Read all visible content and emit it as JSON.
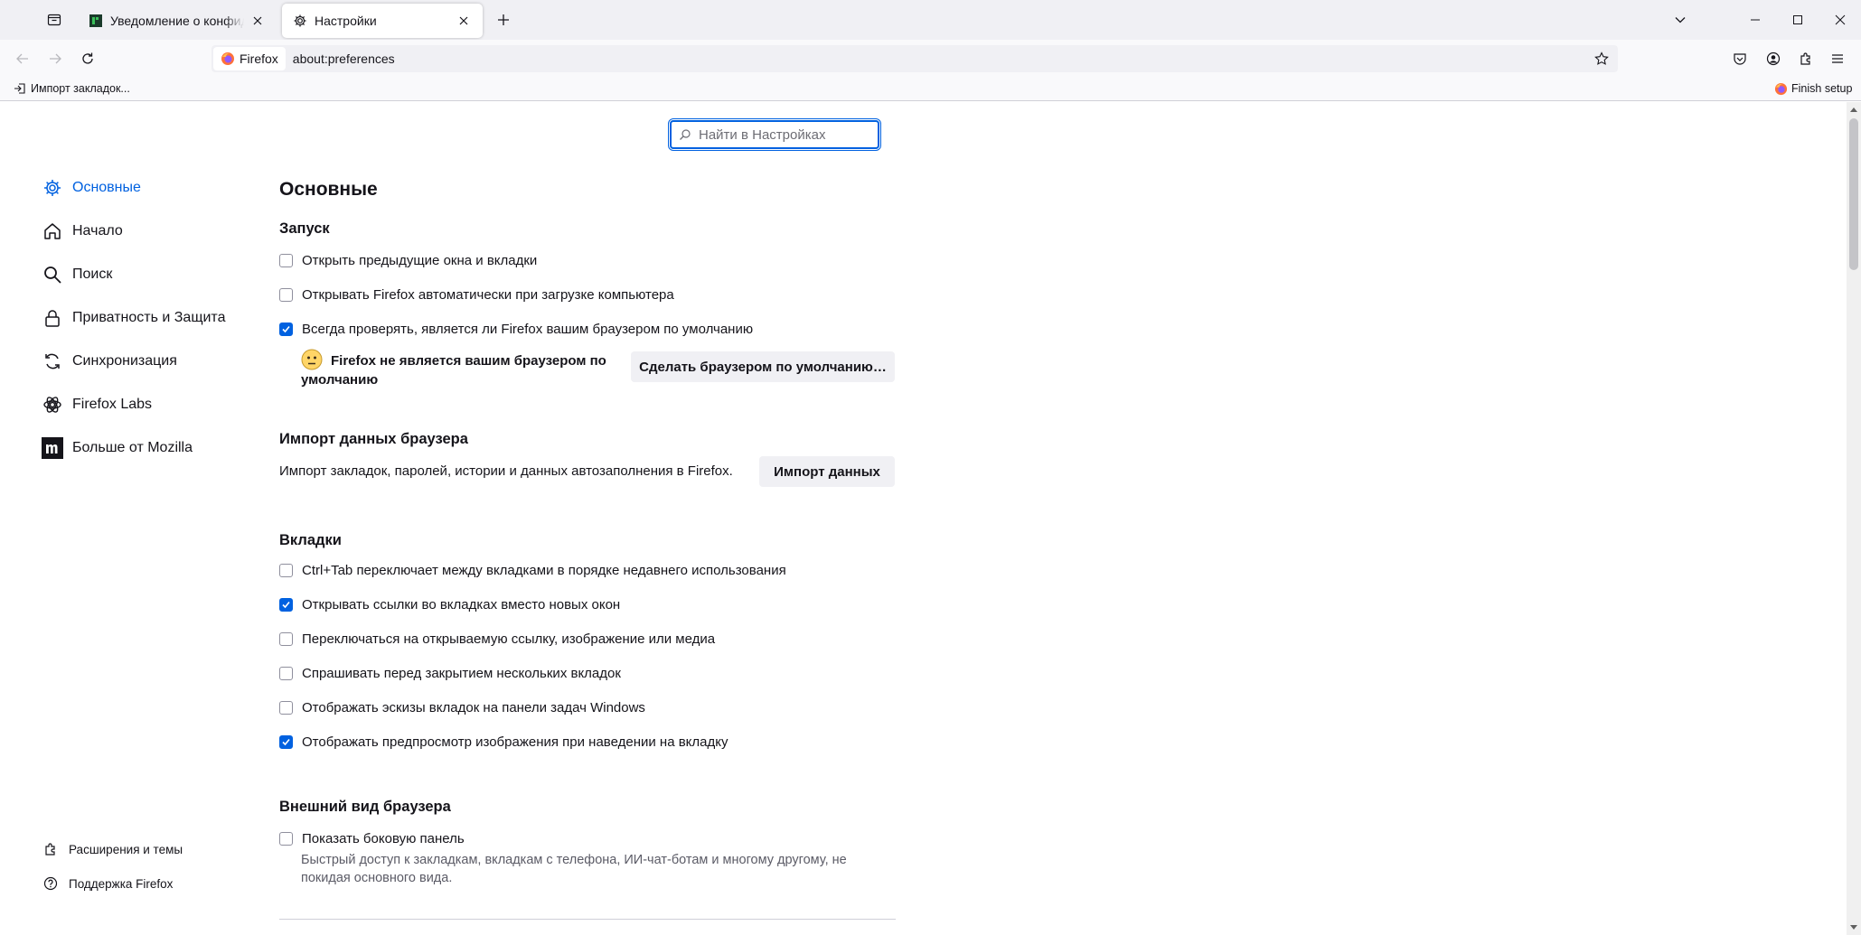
{
  "tabs": [
    {
      "title": "Уведомление о конфиденциальности",
      "active": false
    },
    {
      "title": "Настройки",
      "active": true
    }
  ],
  "urlbar": {
    "identity_label": "Firefox",
    "url": "about:preferences"
  },
  "bookmarks": {
    "import_label": "Импорт закладок...",
    "finish_setup_label": "Finish setup"
  },
  "search": {
    "placeholder": "Найти в Настройках"
  },
  "sidebar": {
    "categories": [
      {
        "label": "Основные",
        "icon": "gear-icon",
        "selected": true
      },
      {
        "label": "Начало",
        "icon": "home-icon",
        "selected": false
      },
      {
        "label": "Поиск",
        "icon": "search-icon",
        "selected": false
      },
      {
        "label": "Приватность и Защита",
        "icon": "lock-icon",
        "selected": false
      },
      {
        "label": "Синхронизация",
        "icon": "sync-icon",
        "selected": false
      },
      {
        "label": "Firefox Labs",
        "icon": "labs-icon",
        "selected": false
      },
      {
        "label": "Больше от Mozilla",
        "icon": "mozilla-icon",
        "selected": false
      }
    ],
    "footer": {
      "addons_label": "Расширения и темы",
      "support_label": "Поддержка Firefox"
    }
  },
  "main": {
    "title": "Основные",
    "startup": {
      "heading": "Запуск",
      "options": [
        {
          "label": "Открыть предыдущие окна и вкладки",
          "checked": false
        },
        {
          "label": "Открывать Firefox автоматически при загрузке компьютера",
          "checked": false
        },
        {
          "label": "Всегда проверять, является ли Firefox вашим браузером по умолчанию",
          "checked": true
        }
      ],
      "default_status": "Firefox не является вашим браузером по умолчанию",
      "default_status_line1": "Firefox не является вашим браузером по",
      "default_status_line2": "умолчанию",
      "make_default_button": "Сделать браузером по умолчанию…"
    },
    "import": {
      "heading": "Импорт данных браузера",
      "description": "Импорт закладок, паролей, истории и данных автозаполнения в Firefox.",
      "button": "Импорт данных"
    },
    "tabs_section": {
      "heading": "Вкладки",
      "options": [
        {
          "label": "Ctrl+Tab переключает между вкладками в порядке недавнего использования",
          "checked": false
        },
        {
          "label": "Открывать ссылки во вкладках вместо новых окон",
          "checked": true
        },
        {
          "label": "Переключаться на открываемую ссылку, изображение или медиа",
          "checked": false
        },
        {
          "label": "Спрашивать перед закрытием нескольких вкладок",
          "checked": false
        },
        {
          "label": "Отображать эскизы вкладок на панели задач Windows",
          "checked": false
        },
        {
          "label": "Отображать предпросмотр изображения при наведении на вкладку",
          "checked": true
        }
      ]
    },
    "appearance": {
      "heading": "Внешний вид браузера",
      "sidebar_option": {
        "label": "Показать боковую панель",
        "checked": false
      },
      "sidebar_desc": "Быстрый доступ к закладкам, вкладкам с телефона, ИИ-чат-ботам и многому другому, не покидая основного вида."
    }
  },
  "colors": {
    "accent": "#0061e0",
    "tabstrip": "#f0f0f4",
    "toolbar": "#f9f9fb"
  }
}
